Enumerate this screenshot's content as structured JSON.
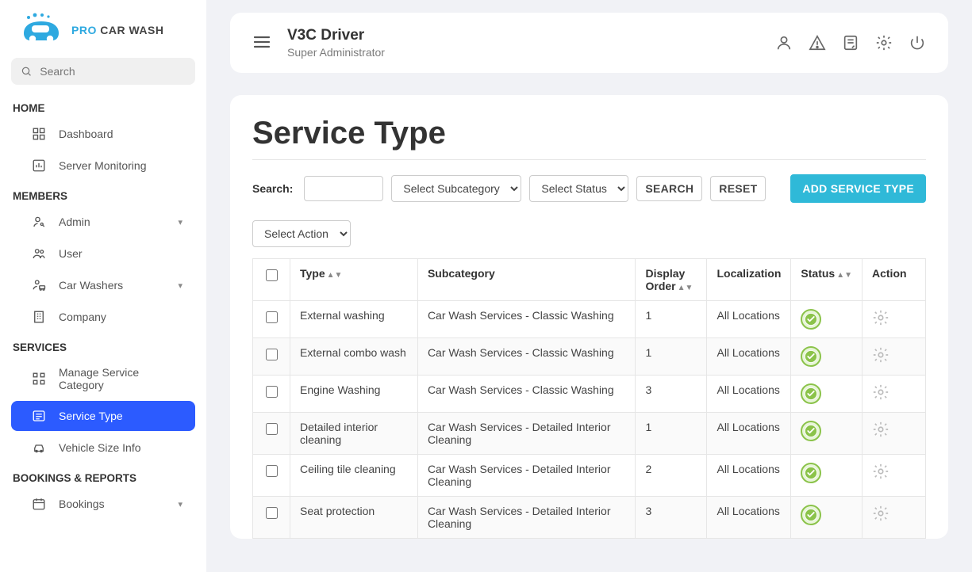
{
  "brand": {
    "p1": "PRO ",
    "p2": "CAR WASH"
  },
  "sidebar": {
    "search_placeholder": "Search",
    "sections": [
      {
        "header": "HOME",
        "items": [
          {
            "label": "Dashboard",
            "icon": "dashboard"
          },
          {
            "label": "Server Monitoring",
            "icon": "chart"
          }
        ]
      },
      {
        "header": "MEMBERS",
        "items": [
          {
            "label": "Admin",
            "icon": "person-key",
            "expandable": true
          },
          {
            "label": "User",
            "icon": "group"
          },
          {
            "label": "Car Washers",
            "icon": "person-car",
            "expandable": true
          },
          {
            "label": "Company",
            "icon": "building"
          }
        ]
      },
      {
        "header": "SERVICES",
        "items": [
          {
            "label": "Manage Service Category",
            "icon": "grid"
          },
          {
            "label": "Service Type",
            "icon": "list",
            "active": true
          },
          {
            "label": "Vehicle Size Info",
            "icon": "car"
          }
        ]
      },
      {
        "header": "BOOKINGS & REPORTS",
        "items": [
          {
            "label": "Bookings",
            "icon": "calendar",
            "expandable": true
          }
        ]
      }
    ]
  },
  "header": {
    "user_name": "V3C Driver",
    "user_role": "Super Administrator"
  },
  "page": {
    "title": "Service Type",
    "search_label": "Search:",
    "subcategory_placeholder": "Select Subcategory",
    "status_placeholder": "Select Status",
    "search_btn": "SEARCH",
    "reset_btn": "RESET",
    "add_btn": "ADD SERVICE TYPE",
    "action_placeholder": "Select Action"
  },
  "table": {
    "cols": {
      "type": "Type",
      "subcategory": "Subcategory",
      "display_order": "Display Order",
      "localization": "Localization",
      "status": "Status",
      "action": "Action"
    },
    "rows": [
      {
        "type": "External washing",
        "sub": "Car Wash Services - Classic Washing",
        "order": "1",
        "loc": "All Locations"
      },
      {
        "type": "External combo wash",
        "sub": "Car Wash Services - Classic Washing",
        "order": "1",
        "loc": "All Locations"
      },
      {
        "type": "Engine Washing",
        "sub": "Car Wash Services - Classic Washing",
        "order": "3",
        "loc": "All Locations"
      },
      {
        "type": "Detailed interior cleaning",
        "sub": "Car Wash Services - Detailed Interior Cleaning",
        "order": "1",
        "loc": "All Locations"
      },
      {
        "type": "Ceiling tile cleaning",
        "sub": "Car Wash Services - Detailed Interior Cleaning",
        "order": "2",
        "loc": "All Locations"
      },
      {
        "type": "Seat protection",
        "sub": "Car Wash Services - Detailed Interior Cleaning",
        "order": "3",
        "loc": "All Locations"
      }
    ]
  }
}
